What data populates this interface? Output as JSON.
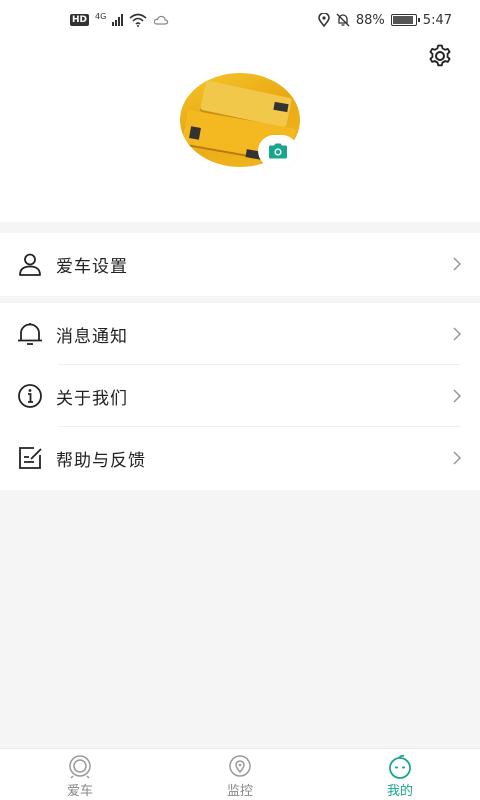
{
  "status_bar": {
    "hd": "HD",
    "network": "4G",
    "battery_percent": "88%",
    "battery_level": 0.88,
    "time": "5:47"
  },
  "profile": {
    "settings_icon": "gear-icon",
    "camera_icon": "camera-icon"
  },
  "menu": {
    "car_settings": "爱车设置",
    "notifications": "消息通知",
    "about_us": "关于我们",
    "help_feedback": "帮助与反馈"
  },
  "tabs": [
    {
      "label": "爱车",
      "icon": "car-icon",
      "active": false
    },
    {
      "label": "监控",
      "icon": "monitor-icon",
      "active": false
    },
    {
      "label": "我的",
      "icon": "profile-face-icon",
      "active": true
    }
  ],
  "colors": {
    "accent": "#18a68c",
    "background": "#f5f5f5",
    "inactive_tab": "#888888"
  }
}
